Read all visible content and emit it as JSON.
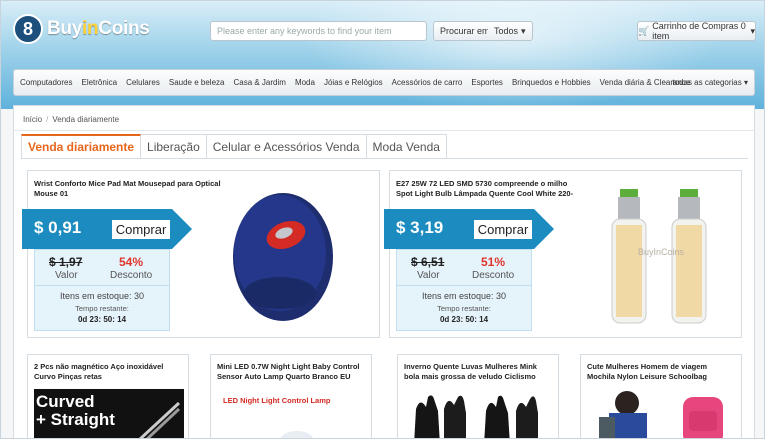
{
  "header": {
    "logo_badge": "8",
    "logo_prefix": "Buy",
    "logo_mid": "in",
    "logo_suffix": "Coins",
    "search_placeholder": "Please enter any keywords to find your item",
    "search_button": "Procurar em",
    "search_scope": "Todos",
    "cart": "Carrinho de Compras 0 item"
  },
  "nav": {
    "items": [
      "Computadores",
      "Eletrônica",
      "Celulares",
      "Saude e beleza",
      "Casa & Jardim",
      "Moda",
      "Jóias e Relógios",
      "Acessórios de carro",
      "Esportes",
      "Brinquedos e Hobbies",
      "Venda diária & Clearance"
    ],
    "all_categories": "todas as categorias"
  },
  "breadcrumb": {
    "home": "Início",
    "current": "Venda diariamente"
  },
  "tabs": [
    "Venda diariamente",
    "Liberação",
    "Celular e Acessórios Venda",
    "Moda Venda"
  ],
  "deals": [
    {
      "title": "Wrist Conforto Mice Pad Mat Mousepad para Optical Mouse 01",
      "price": "$ 0,91",
      "buy_label": "Comprar",
      "old_price": "$ 1,97",
      "old_price_label": "Valor",
      "discount": "54%",
      "discount_label": "Desconto",
      "stock": "Itens em estoque: 30",
      "time_label": "Tempo restante:",
      "timer": "0d 23: 50: 14"
    },
    {
      "title": "E27 25W 72 LED SMD 5730 compreende o milho Spot Light Bulb Lâmpada Quente Cool White 220-",
      "price": "$ 3,19",
      "buy_label": "Comprar",
      "old_price": "$ 6,51",
      "old_price_label": "Valor",
      "discount": "51%",
      "discount_label": "Desconto",
      "stock": "Itens em estoque: 30",
      "time_label": "Tempo restante:",
      "timer": "0d 23: 50: 14",
      "image_watermark": "BuyInCoins"
    }
  ],
  "cards": [
    {
      "title": "2 Pcs não magnético Aço inoxidável Curvo Pinças retas",
      "image_text_1": "Curved",
      "image_text_2": "+ Straight"
    },
    {
      "title": "Mini LED 0.7W Night Light Baby Control Sensor Auto Lamp Quarto Branco EU",
      "image_text_1": "LED Night Light Control Lamp"
    },
    {
      "title": "Inverno Quente Luvas Mulheres Mink bola mais grossa de veludo Ciclismo"
    },
    {
      "title": "Cute Mulheres Homem de viagem Mochila Nylon Leisure Schoolbag"
    }
  ],
  "colors": {
    "accent": "#e8661c",
    "price_flag": "#1b8bc0",
    "discount": "#e0352b",
    "info_bg": "#e5f3fb"
  }
}
